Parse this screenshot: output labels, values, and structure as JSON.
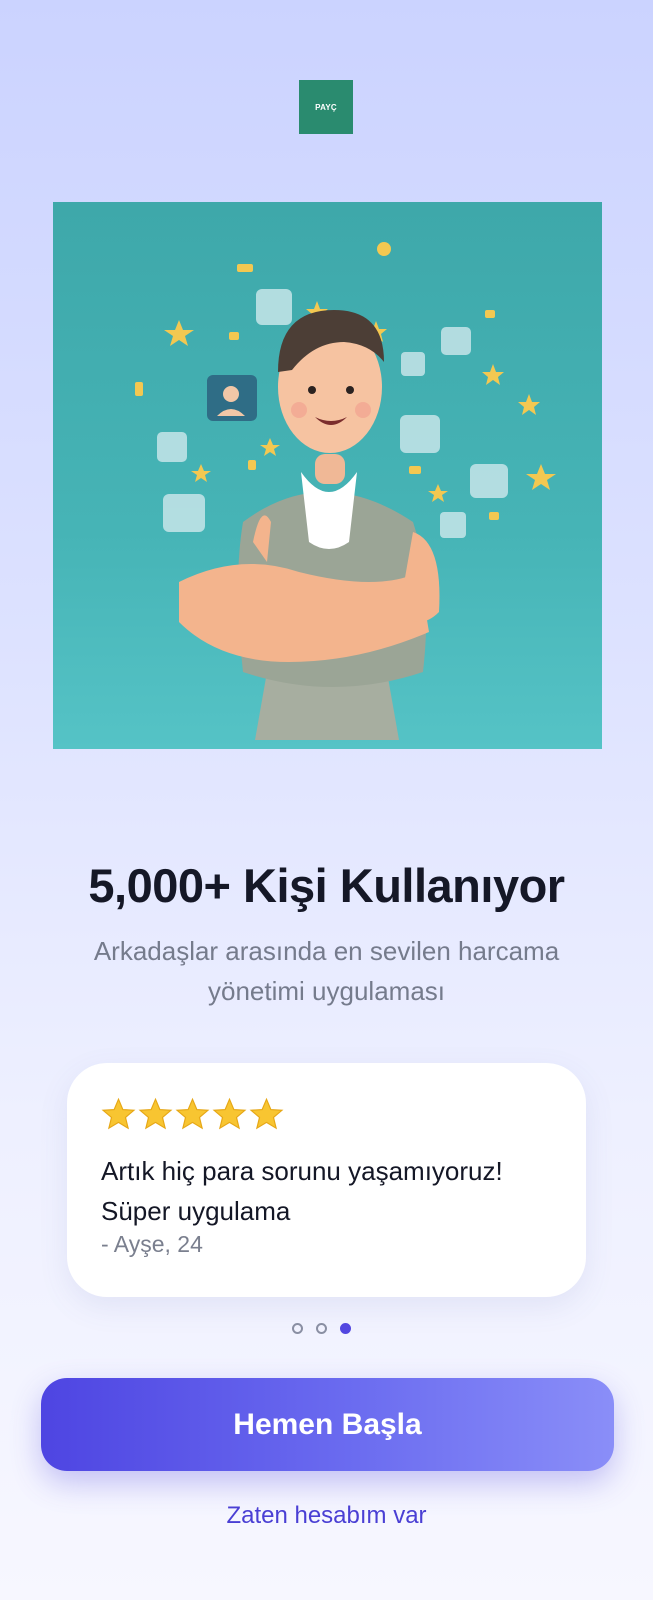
{
  "logo": {
    "text": "PAYÇ",
    "color": "#2a8b6f"
  },
  "hero": {
    "image": "3d-man-with-thumbs-up-and-floating-profile-icons"
  },
  "headline": "5,000+ Kişi Kullanıyor",
  "subtitle": {
    "line1": "Arkadaşlar arasında en sevilen harcama",
    "line2": "yönetimi uygulaması"
  },
  "testimonial": {
    "rating": 5,
    "star_icon": "star-icon",
    "quote_line1": "Artık hiç para sorunu yaşamıyoruz!",
    "quote_line2": "Süper uygulama",
    "author": "- Ayşe, 24"
  },
  "pagination": {
    "total": 3,
    "active_index": 2,
    "active_color": "#5347e0"
  },
  "primary_button": {
    "label": "Hemen Başla"
  },
  "secondary_link": {
    "label": "Zaten hesabım var",
    "color": "#4a3fd4"
  }
}
